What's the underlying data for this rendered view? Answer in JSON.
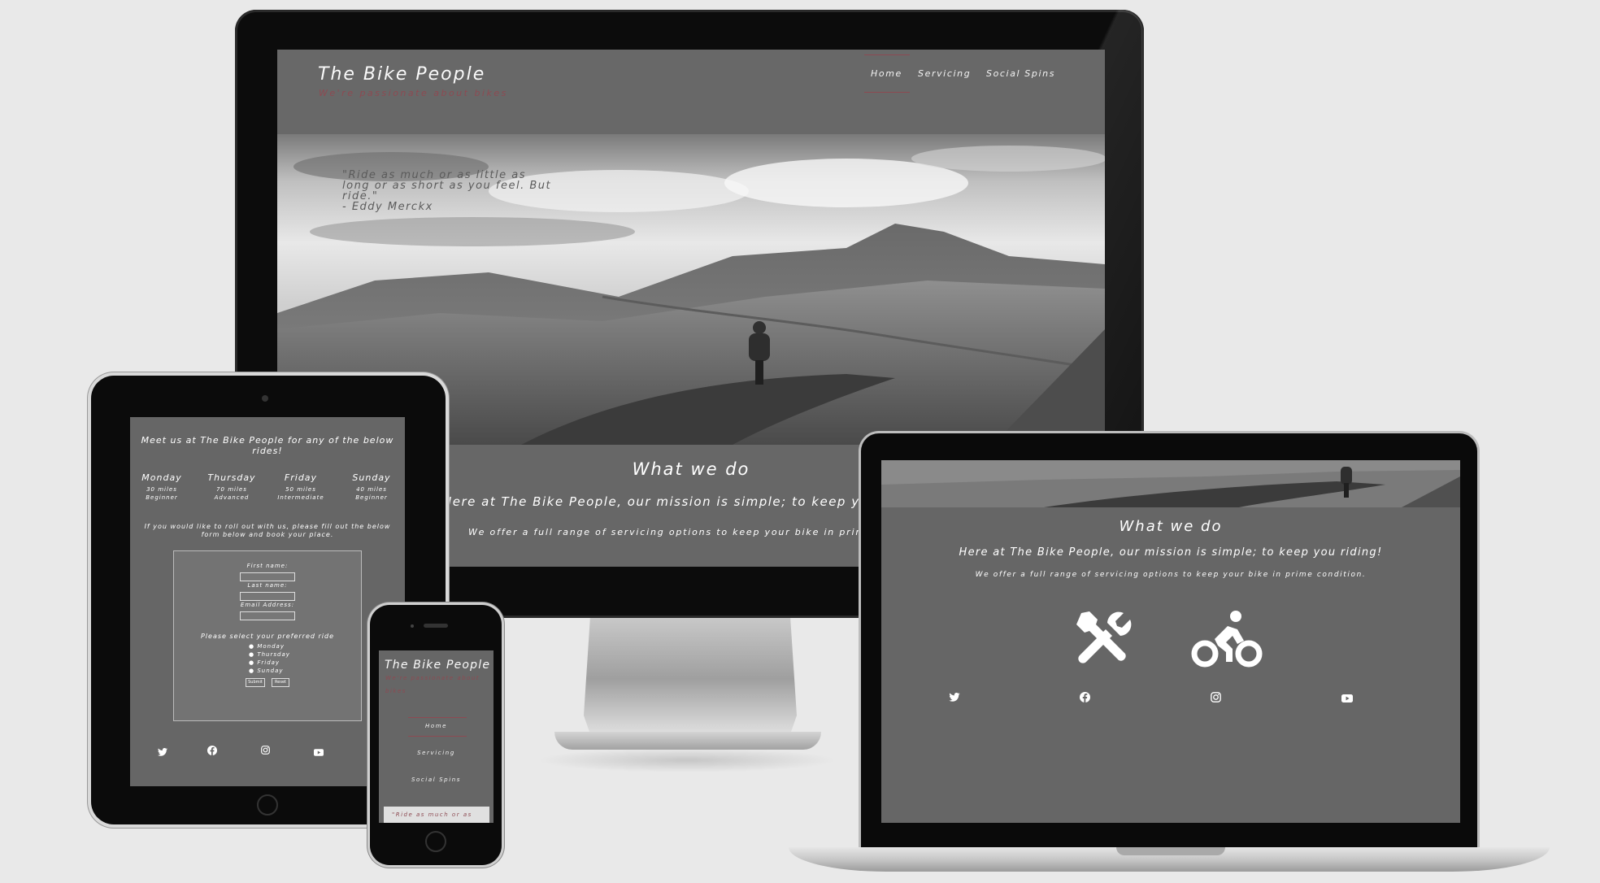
{
  "site": {
    "brand": "The Bike People",
    "tagline": "We're passionate about bikes",
    "nav": [
      "Home",
      "Servicing",
      "Social Spins"
    ]
  },
  "hero": {
    "quote_line1": "\"Ride as much or as little as",
    "quote_line2": "long or as short as you feel. But",
    "quote_line3": "ride.\"",
    "quote_author": "- Eddy Merckx"
  },
  "what_we_do": {
    "heading": "What we do",
    "mission": "Here at The Bike People, our mission is simple; to keep you riding!",
    "mission_cut": "Here at The Bike People, our mission is simple; to keep y",
    "offer": "We offer a full range of servicing options to keep your bike in prime condition.",
    "offer_cut": "We offer a full range of servicing options to keep your bike in prime c"
  },
  "rides": {
    "intro": "Meet us at The Bike People for any of the below rides!",
    "days": [
      {
        "day": "Monday",
        "distance": "30 miles",
        "level": "Beginner"
      },
      {
        "day": "Thursday",
        "distance": "70 miles",
        "level": "Advanced"
      },
      {
        "day": "Friday",
        "distance": "50 miles",
        "level": "Intermediate"
      },
      {
        "day": "Sunday",
        "distance": "40 miles",
        "level": "Beginner"
      }
    ],
    "form_intro": "If you would like to roll out with us, please fill out the below form below and book your place."
  },
  "form": {
    "first_name": "First name:",
    "last_name": "Last name:",
    "email": "Email Address:",
    "ride_prompt": "Please select your preferred ride",
    "options": [
      "Monday",
      "Thursday",
      "Friday",
      "Sunday"
    ],
    "submit": "Submit",
    "reset": "Reset"
  },
  "phone": {
    "brand": "The Bike People",
    "tagline_line1": "We're passionate about",
    "tagline_line2": "bikes",
    "quote_snippet": "\"Ride as much or as"
  },
  "icons": {
    "services": [
      "tools-icon",
      "cyclist-icon"
    ],
    "social": [
      "twitter-icon",
      "facebook-icon",
      "instagram-icon",
      "youtube-icon"
    ]
  },
  "colors": {
    "page_bg": "#e9e9e9",
    "site_bg": "#676767",
    "accent": "#8d4a52",
    "text": "#fafafa"
  }
}
